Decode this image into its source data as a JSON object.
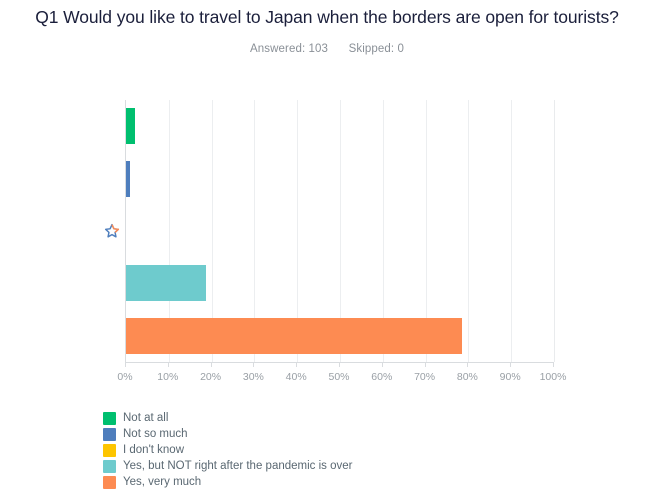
{
  "header": {
    "title": "Q1 Would you like to travel to Japan when the borders are open for tourists?",
    "answered_label": "Answered: 103",
    "skipped_label": "Skipped: 0"
  },
  "star_icon_name": "star-icon",
  "chart_data": {
    "type": "bar",
    "orientation": "horizontal",
    "title": "Q1 Would you like to travel to Japan when the borders are open for tourists?",
    "xlabel": "",
    "ylabel": "",
    "xlim": [
      0,
      100
    ],
    "grid": true,
    "legend_position": "bottom-left",
    "tick_labels": [
      "0%",
      "10%",
      "20%",
      "30%",
      "40%",
      "50%",
      "60%",
      "70%",
      "80%",
      "90%",
      "100%"
    ],
    "tick_values": [
      0,
      10,
      20,
      30,
      40,
      50,
      60,
      70,
      80,
      90,
      100
    ],
    "categories": [
      "Not at all",
      "Not so much",
      "I don't know",
      "Yes, but NOT right after the pandemic is over",
      "Yes, very much"
    ],
    "values": [
      2,
      1,
      0,
      18.7,
      78.5
    ],
    "colors": [
      "#00bf6f",
      "#4e7ebd",
      "#fdc500",
      "#6ecbcd",
      "#fd8b52"
    ],
    "answered": 103,
    "skipped": 0
  },
  "legend": {
    "items": [
      {
        "label": "Not at all",
        "color": "#00bf6f"
      },
      {
        "label": "Not so much",
        "color": "#4e7ebd"
      },
      {
        "label": "I don't know",
        "color": "#fdc500"
      },
      {
        "label": "Yes, but NOT right after the pandemic is over",
        "color": "#6ecbcd"
      },
      {
        "label": "Yes, very much",
        "color": "#fd8b52"
      }
    ]
  }
}
